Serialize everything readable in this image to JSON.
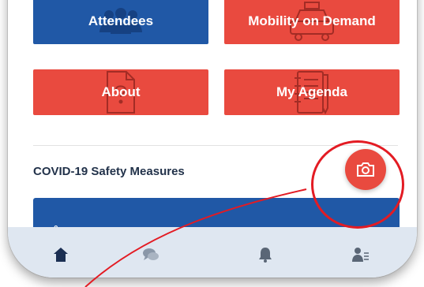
{
  "tiles": [
    {
      "label": "Attendees",
      "color": "#2058a6",
      "icon": "people-icon"
    },
    {
      "label": "Mobility on Demand",
      "color": "#e94a3f",
      "icon": "taxi-icon"
    },
    {
      "label": "About",
      "color": "#e94a3f",
      "icon": "document-question-icon"
    },
    {
      "label": "My Agenda",
      "color": "#e94a3f",
      "icon": "agenda-notebook-icon"
    }
  ],
  "section": {
    "title": "COVID-19 Safety Measures"
  },
  "fab": {
    "icon": "camera-icon",
    "color": "#e94a3f"
  },
  "bottom_nav": [
    {
      "icon": "home-icon",
      "active": true
    },
    {
      "icon": "chat-bubbles-icon",
      "active": false
    },
    {
      "icon": "bell-icon",
      "active": false
    },
    {
      "icon": "profile-list-icon",
      "active": false
    }
  ],
  "colors": {
    "accent_blue": "#2058a6",
    "accent_red": "#e94a3f",
    "annotation": "#e31b23",
    "nav_bg": "#dfe7f1"
  }
}
